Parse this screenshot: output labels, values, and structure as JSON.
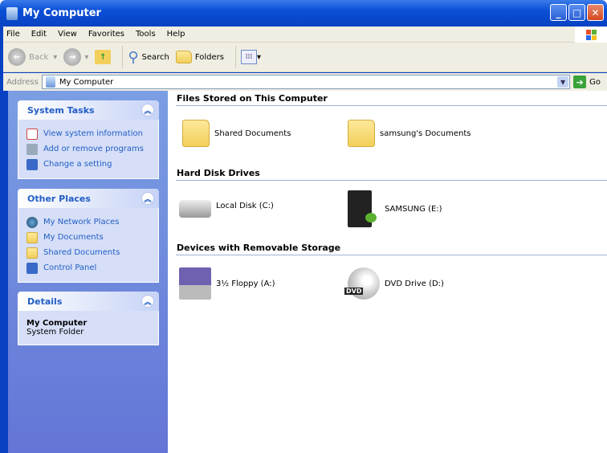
{
  "window": {
    "title": "My Computer",
    "buttons": {
      "minimize": "_",
      "maximize": "□",
      "close": "✕"
    }
  },
  "menu": [
    "File",
    "Edit",
    "View",
    "Favorites",
    "Tools",
    "Help"
  ],
  "toolbar": {
    "back": "Back",
    "search": "Search",
    "folders": "Folders"
  },
  "address": {
    "label": "Address",
    "value": "My Computer",
    "go": "Go"
  },
  "sidebar": {
    "system_tasks": {
      "title": "System Tasks",
      "items": [
        "View system information",
        "Add or remove programs",
        "Change a setting"
      ]
    },
    "other_places": {
      "title": "Other Places",
      "items": [
        "My Network Places",
        "My Documents",
        "Shared Documents",
        "Control Panel"
      ]
    },
    "details": {
      "title": "Details",
      "name": "My Computer",
      "type": "System Folder"
    }
  },
  "main": {
    "files": {
      "title": "Files Stored on This Computer",
      "items": [
        "Shared Documents",
        "samsung's Documents"
      ]
    },
    "hdd": {
      "title": "Hard Disk Drives",
      "items": [
        "Local Disk (C:)",
        "SAMSUNG (E:)"
      ]
    },
    "removable": {
      "title": "Devices with Removable Storage",
      "items": [
        "3½ Floppy (A:)",
        "DVD Drive (D:)"
      ],
      "dvd_badge": "DVD"
    }
  }
}
